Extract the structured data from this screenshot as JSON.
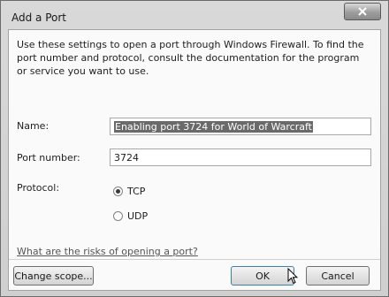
{
  "window": {
    "title": "Add a Port",
    "close_icon": "close-icon"
  },
  "description": "Use these settings to open a port through Windows Firewall. To find the port number and protocol, consult the documentation for the program or service you want to use.",
  "form": {
    "name_label": "Name:",
    "name_value": "Enabling port 3724 for World of Warcraft",
    "port_label": "Port number:",
    "port_value": "3724",
    "protocol_label": "Protocol:",
    "protocols": [
      {
        "label": "TCP",
        "selected": true
      },
      {
        "label": "UDP",
        "selected": false
      }
    ]
  },
  "risk_link": "What are the risks of opening a port?",
  "buttons": {
    "change_scope": "Change scope...",
    "ok": "OK",
    "cancel": "Cancel"
  }
}
